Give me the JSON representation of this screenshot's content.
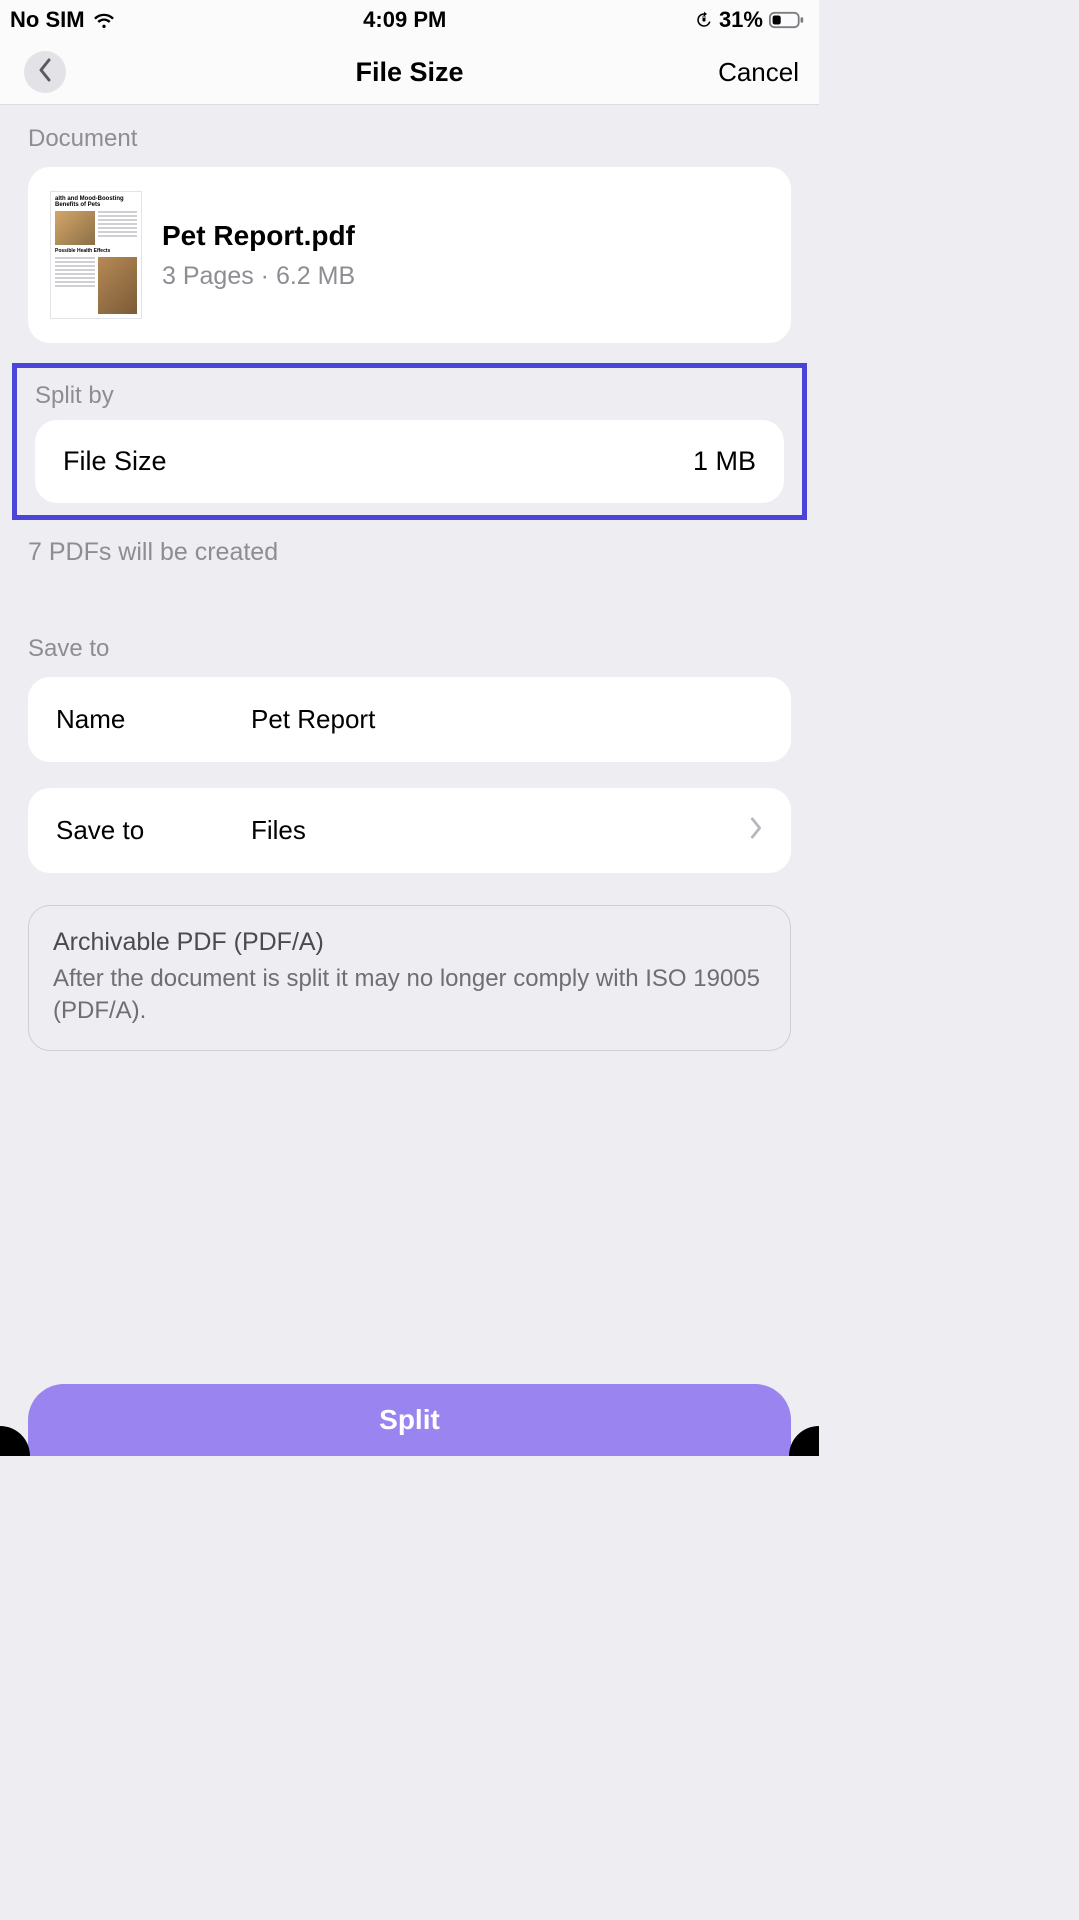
{
  "status": {
    "sim": "No SIM",
    "time": "4:09 PM",
    "battery_pct": "31%"
  },
  "nav": {
    "title": "File Size",
    "cancel": "Cancel"
  },
  "document_section": {
    "label": "Document",
    "file_name": "Pet Report.pdf",
    "subtitle": "3 Pages · 6.2 MB",
    "thumb_headline": "alth and Mood-Boosting Benefits of Pets",
    "thumb_section": "Possible Health Effects"
  },
  "split_section": {
    "label": "Split by",
    "key": "File Size",
    "value": "1 MB",
    "hint": "7 PDFs will be created"
  },
  "save_section": {
    "label": "Save to",
    "name_key": "Name",
    "name_value": "Pet Report",
    "dest_key": "Save to",
    "dest_value": "Files"
  },
  "notice": {
    "title": "Archivable PDF (PDF/A)",
    "body": "After the document is split it may no longer comply with ISO 19005 (PDF/A)."
  },
  "action": {
    "split": "Split"
  }
}
